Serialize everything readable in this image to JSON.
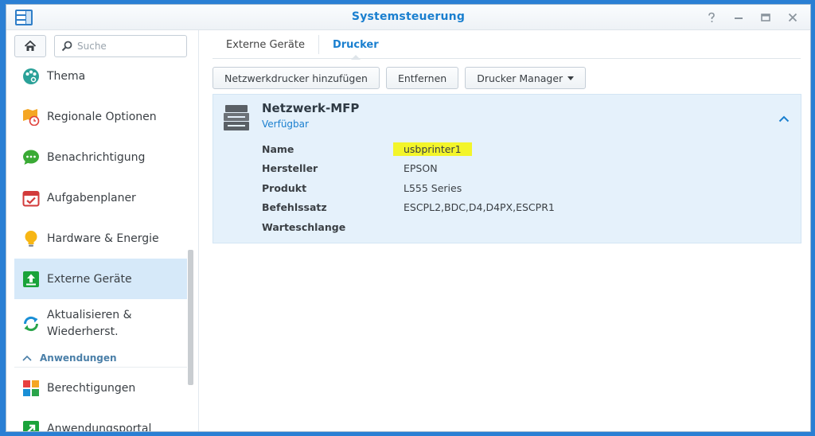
{
  "window": {
    "title": "Systemsteuerung"
  },
  "sidebar": {
    "search_placeholder": "Suche",
    "items": [
      {
        "label": "Thema"
      },
      {
        "label": "Regionale Optionen"
      },
      {
        "label": "Benachrichtigung"
      },
      {
        "label": "Aufgabenplaner"
      },
      {
        "label": "Hardware & Energie"
      },
      {
        "label": "Externe Geräte"
      },
      {
        "label_line1": "Aktualisieren &",
        "label_line2": "Wiederherst."
      }
    ],
    "section_label": "Anwendungen",
    "section_items": [
      {
        "label": "Berechtigungen"
      },
      {
        "label": "Anwendungsportal"
      }
    ]
  },
  "main": {
    "tabs": [
      {
        "label": "Externe Geräte"
      },
      {
        "label": "Drucker"
      }
    ],
    "toolbar": {
      "add_label": "Netzwerkdrucker hinzufügen",
      "remove_label": "Entfernen",
      "manager_label": "Drucker Manager"
    },
    "printer": {
      "name": "Netzwerk-MFP",
      "status": "Verfügbar",
      "properties": [
        {
          "key": "Name",
          "value": "usbprinter1"
        },
        {
          "key": "Hersteller",
          "value": "EPSON"
        },
        {
          "key": "Produkt",
          "value": "L555 Series"
        },
        {
          "key": "Befehlssatz",
          "value": "ESCPL2,BDC,D4,D4PX,ESCPR1"
        },
        {
          "key": "Warteschlange",
          "value": ""
        }
      ]
    }
  },
  "colors": {
    "accent": "#1a7fcf",
    "active_nav_bg": "#d6e9f9",
    "card_bg": "#e5f1fb",
    "highlight": "#f3f52a"
  }
}
